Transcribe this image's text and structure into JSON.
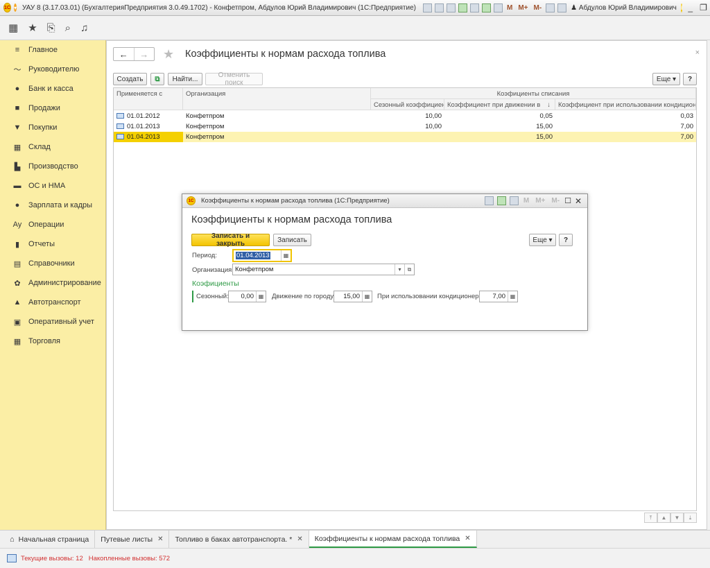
{
  "window": {
    "title": "УАУ 8 (3.17.03.01) (БухгалтерияПредприятия 3.0.49.1702) - Конфетпром, Абдулов Юрий Владимирович (1С:Предприятие)",
    "user": "Абдулов Юрий Владимирович",
    "m_buttons": [
      "M",
      "M+",
      "M-"
    ]
  },
  "sidebar": {
    "items": [
      {
        "label": "Главное",
        "icon": "≡"
      },
      {
        "label": "Руководителю",
        "icon": "〜"
      },
      {
        "label": "Банк и касса",
        "icon": "●"
      },
      {
        "label": "Продажи",
        "icon": "■"
      },
      {
        "label": "Покупки",
        "icon": "▼"
      },
      {
        "label": "Склад",
        "icon": "▦"
      },
      {
        "label": "Производство",
        "icon": "▙"
      },
      {
        "label": "ОС и НМА",
        "icon": "▬"
      },
      {
        "label": "Зарплата и кадры",
        "icon": "●"
      },
      {
        "label": "Операции",
        "icon": "Ay"
      },
      {
        "label": "Отчеты",
        "icon": "▮"
      },
      {
        "label": "Справочники",
        "icon": "▤"
      },
      {
        "label": "Администрирование",
        "icon": "✿"
      },
      {
        "label": "Автотранспорт",
        "icon": "▲"
      },
      {
        "label": "Оперативный учет",
        "icon": "▣"
      },
      {
        "label": "Торговля",
        "icon": "▦"
      }
    ]
  },
  "main": {
    "title": "Коэффициенты к нормам расхода топлива",
    "buttons": {
      "create": "Создать",
      "find": "Найти...",
      "cancel_search": "Отменить поиск",
      "more": "Еще",
      "help": "?"
    },
    "table": {
      "headers": {
        "applies_from": "Применяется с",
        "organization": "Организация",
        "group": "Коэфициенты списания",
        "seasonal": "Сезонный коэффициент",
        "movement": "Коэффициент при движении в",
        "ac": "Коэффициент при использовании кондиционера"
      },
      "rows": [
        {
          "date": "01.01.2012",
          "org": "Конфетпром",
          "seasonal": "10,00",
          "movement": "0,05",
          "ac": "0,03"
        },
        {
          "date": "01.01.2013",
          "org": "Конфетпром",
          "seasonal": "10,00",
          "movement": "15,00",
          "ac": "7,00"
        },
        {
          "date": "01.04.2013",
          "org": "Конфетпром",
          "seasonal": "",
          "movement": "15,00",
          "ac": "7,00"
        }
      ]
    }
  },
  "dialog": {
    "window_title": "Коэффициенты к нормам расхода топлива  (1С:Предприятие)",
    "heading": "Коэффициенты к нормам расхода топлива",
    "save_close": "Записать и закрыть",
    "save": "Записать",
    "more": "Еще",
    "help": "?",
    "period_label": "Период:",
    "period_value": "01.04.2013",
    "org_label": "Организация:",
    "org_value": "Конфетпром",
    "group_title": "Коэфициенты",
    "seasonal_label": "Сезонный:",
    "seasonal_value": "0,00",
    "city_label": "Движение по городу:",
    "city_value": "15,00",
    "ac_label": "При использовании кондиционера:",
    "ac_value": "7,00"
  },
  "tabs": [
    {
      "label": "Начальная страница",
      "closable": false
    },
    {
      "label": "Путевые листы",
      "closable": true
    },
    {
      "label": "Топливо в баках автотранспорта. *",
      "closable": true
    },
    {
      "label": "Коэффициенты к нормам расхода топлива",
      "closable": true,
      "active": true
    }
  ],
  "status": {
    "current_calls": "Текущие вызовы: 12",
    "accumulated_calls": "Накопленные вызовы: 572"
  }
}
